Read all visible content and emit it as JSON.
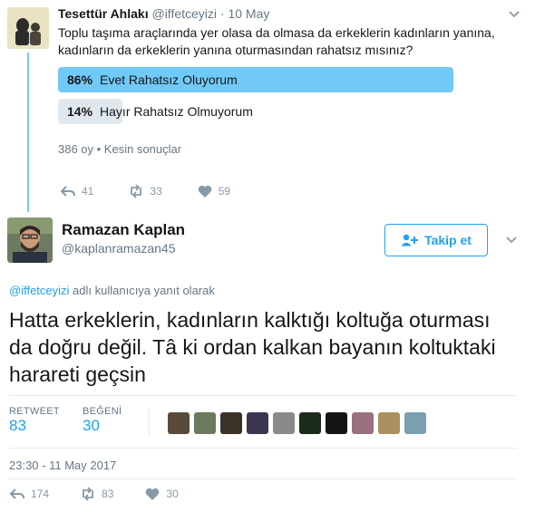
{
  "parent_tweet": {
    "display_name": "Tesettür Ahlakı",
    "handle": "@iffetceyizi",
    "separator": "·",
    "date": "10 May",
    "text": "Toplu taşıma araçlarında yer olasa da olmasa da erkeklerin kadınların yanına, kadınların da erkeklerin yanına oturmasından rahatsız mısınız?",
    "poll": {
      "options": [
        {
          "percent_label": "86%",
          "label": "Evet Rahatsız Oluyorum",
          "percent": 86,
          "color": "#71c9f8"
        },
        {
          "percent_label": "14%",
          "label": "Hayır Rahatsız Olmuyorum",
          "percent": 14,
          "color": "#e1e8ed"
        }
      ],
      "votes_label": "386 oy • Kesin sonuçlar"
    },
    "actions": {
      "replies": "41",
      "retweets": "33",
      "likes": "59"
    }
  },
  "main_tweet": {
    "display_name": "Ramazan Kaplan",
    "handle": "@kaplanramazan45",
    "follow_label": "Takip et",
    "reply_to_handle": "@iffetceyizi",
    "reply_to_suffix": "adlı kullanıcıya yanıt olarak",
    "text": "Hatta erkeklerin, kadınların kalktığı koltuğa oturması da doğru değil. Tâ ki ordan kalkan bayanın koltuktaki harareti geçsin",
    "stats": {
      "retweet_label": "RETWEET",
      "retweet_value": "83",
      "like_label": "BEĞENİ",
      "like_value": "30"
    },
    "likers_colors": [
      "#5a4a3a",
      "#6b7a5c",
      "#3a3228",
      "#3b3550",
      "#8a8a8a",
      "#1c2a1c",
      "#151515",
      "#9a7080",
      "#a89060",
      "#7aa0b0"
    ],
    "timestamp": "23:30 - 11 May 2017",
    "actions": {
      "replies": "174",
      "retweets": "83",
      "likes": "30"
    }
  },
  "colors": {
    "accent": "#1da1f2",
    "thread_line": "#7fc6e8",
    "muted": "#657786",
    "icon_gray": "#8899a6"
  }
}
